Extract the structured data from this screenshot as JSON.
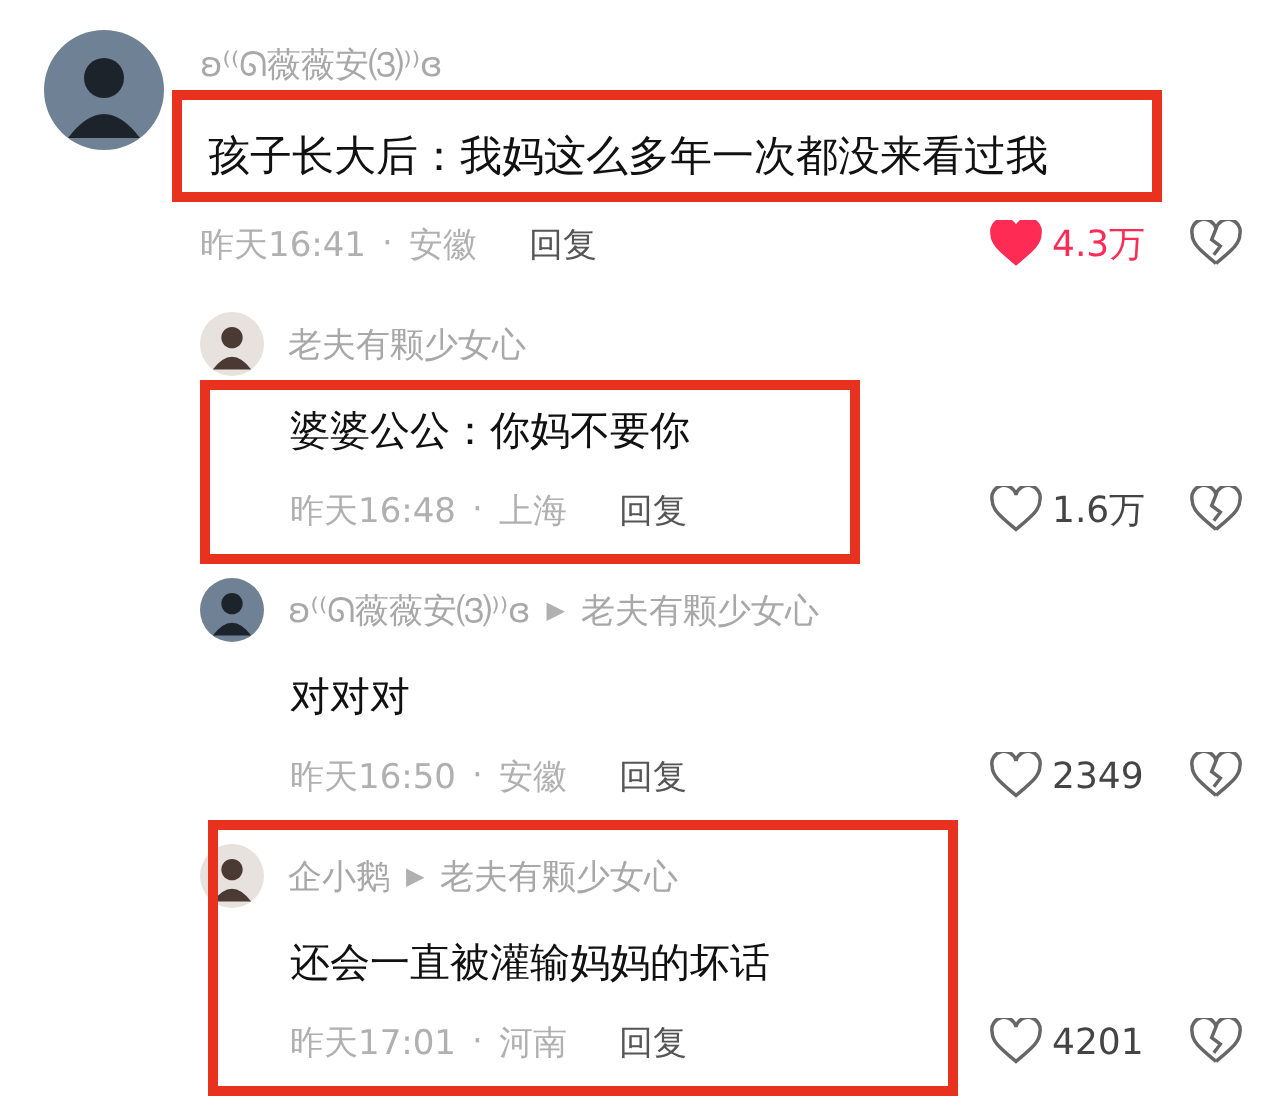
{
  "comments": [
    {
      "author": "ʚ⁽⁽ᘏ薇薇安⑶⁾⁾ɞ",
      "color": "#6f8194",
      "text": "孩子长大后：我妈这么多年一次都没来看过我",
      "time": "昨天16:41",
      "separator": "·",
      "location": "安徽",
      "reply": "回复",
      "likes": "4.3万",
      "liked": true,
      "highlighted": true,
      "highlight_covers_name": false,
      "highlight_covers_meta": false,
      "children": [
        {
          "author": "老夫有颗少女心",
          "color": "#e8e2de",
          "text": "婆婆公公：你妈不要你",
          "time": "昨天16:48",
          "separator": "·",
          "location": "上海",
          "reply": "回复",
          "likes": "1.6万",
          "liked": false,
          "highlighted": true,
          "highlight_covers_name": false,
          "highlight_covers_meta": true
        },
        {
          "author": "ʚ⁽⁽ᘏ薇薇安⑶⁾⁾ɞ",
          "color": "#6f8194",
          "reply_arrow": "▶",
          "reply_to": "老夫有颗少女心",
          "text": "对对对",
          "time": "昨天16:50",
          "separator": "·",
          "location": "安徽",
          "reply": "回复",
          "likes": "2349",
          "liked": false,
          "highlighted": false
        },
        {
          "author": "企小鹅",
          "color": "#e8e2de",
          "reply_arrow": "▶",
          "reply_to": "老夫有颗少女心",
          "text": "还会一直被灌输妈妈的坏话",
          "time": "昨天17:01",
          "separator": "·",
          "location": "河南",
          "reply": "回复",
          "likes": "4201",
          "liked": false,
          "highlighted": true,
          "highlight_covers_name": true,
          "highlight_covers_meta": true
        }
      ]
    }
  ]
}
